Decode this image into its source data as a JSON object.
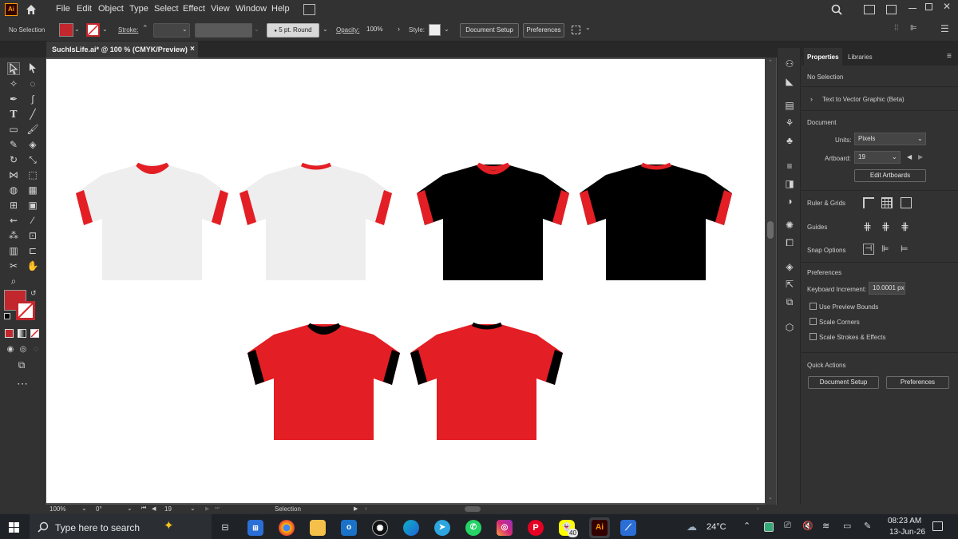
{
  "menubar": {
    "app_logo": "Ai",
    "items": [
      "File",
      "Edit",
      "Object",
      "Type",
      "Select",
      "Effect",
      "View",
      "Window",
      "Help"
    ]
  },
  "controlbar": {
    "selection_label": "No Selection",
    "stroke_label": "Stroke:",
    "brush_value": "5 pt. Round",
    "opacity_label": "Opacity:",
    "opacity_value": "100%",
    "style_label": "Style:",
    "document_setup": "Document Setup",
    "preferences": "Preferences"
  },
  "document_tab": {
    "title": "SuchIsLife.ai* @ 100 % (CMYK/Preview)",
    "close": "×"
  },
  "properties_panel": {
    "tabs": [
      "Properties",
      "Libraries"
    ],
    "selection_state": "No Selection",
    "text_to_vector": "Text to Vector Graphic (Beta)",
    "document_section": "Document",
    "units_label": "Units:",
    "units_value": "Pixels",
    "artboard_label": "Artboard:",
    "artboard_value": "19",
    "edit_artboards": "Edit Artboards",
    "ruler_grids": "Ruler & Grids",
    "guides": "Guides",
    "snap_options": "Snap Options",
    "preferences_section": "Preferences",
    "keyboard_increment_label": "Keyboard Increment:",
    "keyboard_increment_value": "10.0001 px",
    "checkboxes": [
      "Use Preview Bounds",
      "Scale Corners",
      "Scale Strokes & Effects"
    ],
    "quick_actions": "Quick Actions",
    "document_setup_btn": "Document Setup",
    "preferences_btn": "Preferences"
  },
  "statusbar": {
    "zoom": "100%",
    "rotation": "0°",
    "artboard_number": "19",
    "tool_name": "Selection"
  },
  "taskbar": {
    "search_placeholder": "Type here to search",
    "weather": "24°C",
    "time": "08:23 AM",
    "date": "13-Jun-26",
    "badge": "40",
    "ai_icon": "Ai"
  },
  "colors": {
    "accent_red": "#e31e24",
    "fill_swatch": "#c1272d",
    "shirt_white": "#eeeeef",
    "shirt_black": "#000000"
  },
  "artwork": {
    "shirts": [
      {
        "body": "white",
        "trim": "red"
      },
      {
        "body": "white",
        "trim": "red"
      },
      {
        "body": "black",
        "trim": "red"
      },
      {
        "body": "black",
        "trim": "red"
      },
      {
        "body": "red",
        "trim": "black"
      },
      {
        "body": "red",
        "trim": "black"
      }
    ]
  }
}
